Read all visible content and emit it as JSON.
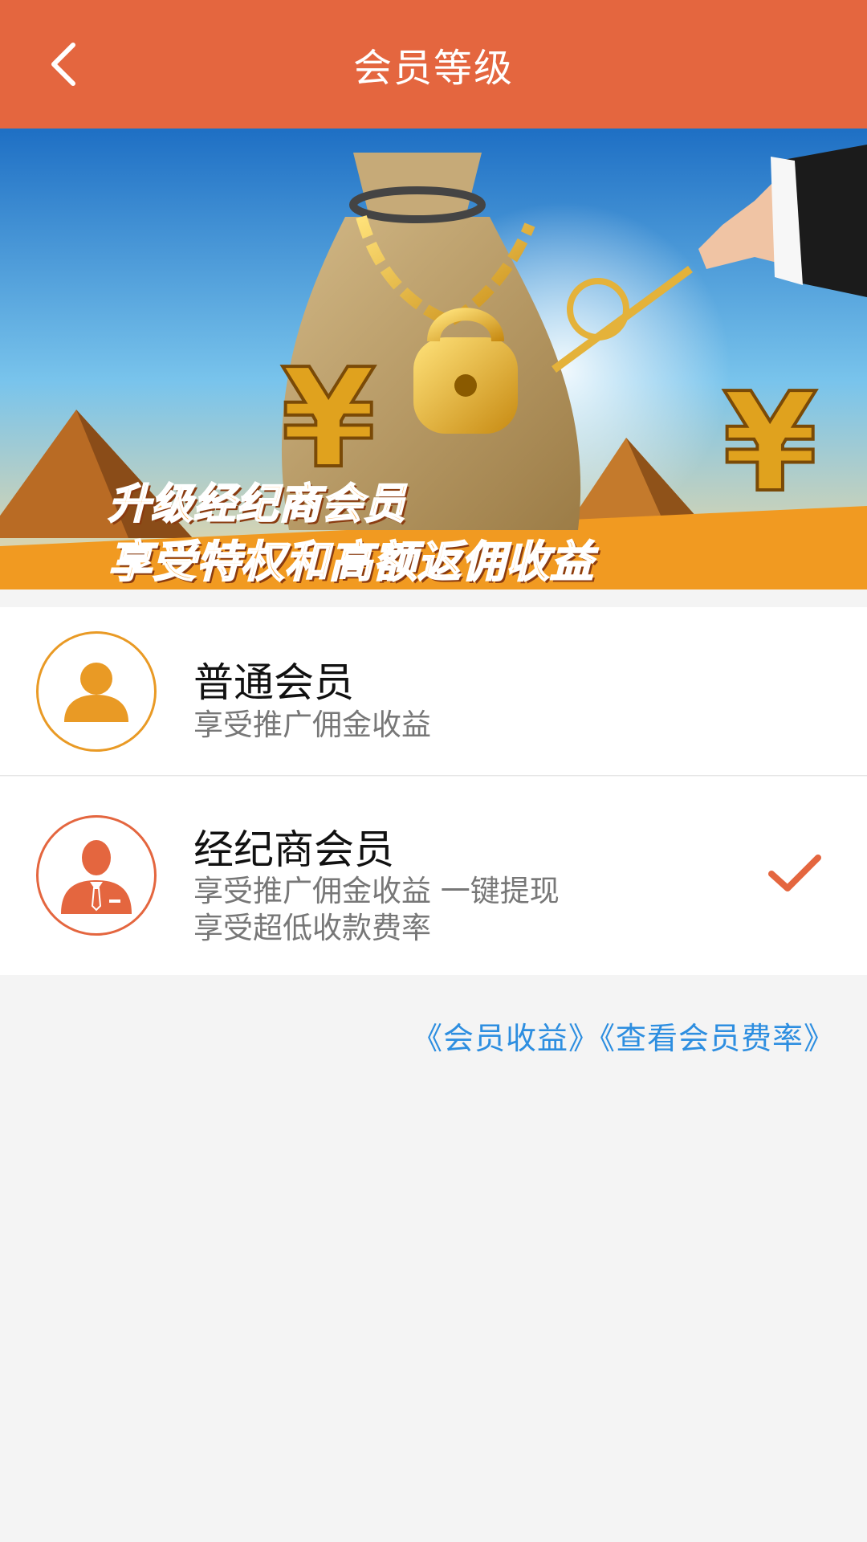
{
  "header": {
    "title": "会员等级",
    "back_icon": "chevron-left-icon"
  },
  "banner": {
    "line1": "升级经纪商会员",
    "line2": "享受特权和高额返佣收益"
  },
  "members": [
    {
      "title": "普通会员",
      "desc": "享受推广佣金收益",
      "icon": "user-icon",
      "icon_color": "#e99a25",
      "selected": false
    },
    {
      "title": "经纪商会员",
      "desc_line1": "享受推广佣金收益 一键提现",
      "desc_line2": "享受超低收款费率",
      "icon": "businessman-icon",
      "icon_color": "#e4663f",
      "selected": true,
      "check_icon": "checkmark-icon"
    }
  ],
  "links": {
    "benefits": "《会员收益》",
    "rates": "《查看会员费率》"
  },
  "colors": {
    "header_bg": "#e4663f",
    "link": "#2d8ee0",
    "page_bg": "#f4f4f4"
  }
}
